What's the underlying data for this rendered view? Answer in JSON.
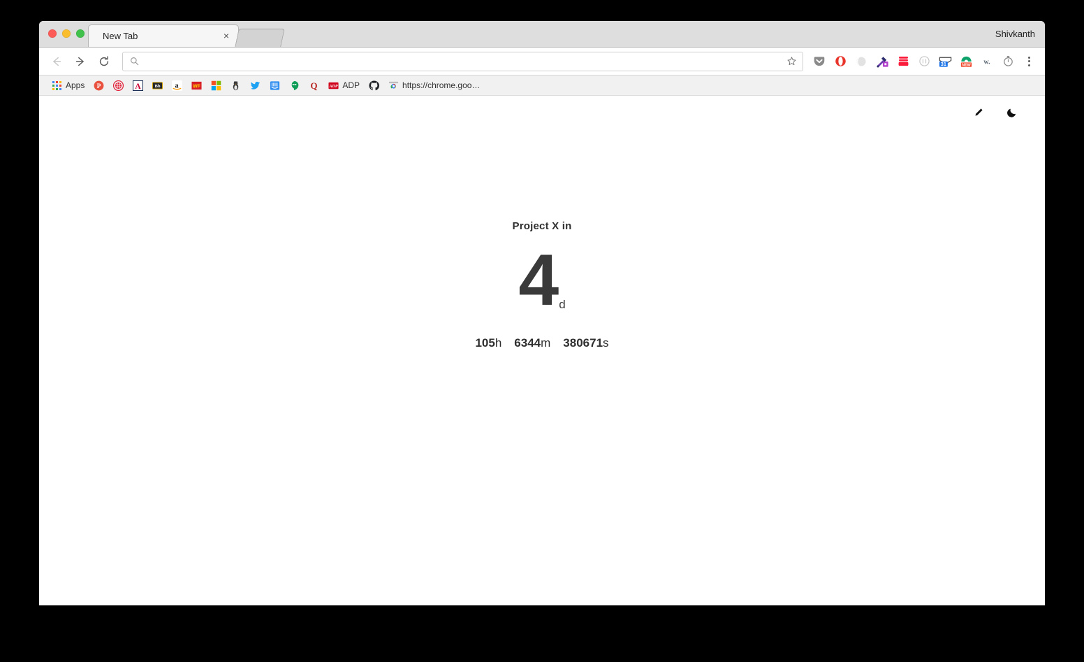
{
  "window": {
    "profile_name": "Shivkanth",
    "traffic_lights": [
      "close-red",
      "minimize-yellow",
      "maximize-green"
    ]
  },
  "tabs": [
    {
      "title": "New Tab",
      "close_label": "×",
      "active": true
    }
  ],
  "toolbar": {
    "back_label": "Back",
    "forward_label": "Forward",
    "reload_label": "Reload",
    "omnibox_value": "",
    "omnibox_placeholder": "",
    "search_icon": "search-icon",
    "star_icon": "bookmark-star-icon",
    "menu_icon": "chrome-menu-icon",
    "extensions": [
      {
        "name": "pocket-extension-icon",
        "color": "#8a8a8a"
      },
      {
        "name": "opera-extension-icon",
        "color": "#e8342a"
      },
      {
        "name": "ghost-extension-icon",
        "color": "#d8d8d8"
      },
      {
        "name": "eyedropper-extension-icon",
        "color": "#b13ecb"
      },
      {
        "name": "red-box-extension-icon",
        "color": "#fb1b3a"
      },
      {
        "name": "circle-outline-extension-icon",
        "color": "#bdbdbd"
      },
      {
        "name": "calendar-31-extension-icon",
        "color": "#1a73e8",
        "badge": "31"
      },
      {
        "name": "new-badge-extension-icon",
        "color": "#0fa36b",
        "badge": "NEW"
      },
      {
        "name": "wikiwand-extension-icon",
        "color": "#5d6a77",
        "label": "w."
      },
      {
        "name": "stopwatch-extension-icon",
        "color": "#8a8a8a"
      }
    ]
  },
  "bookmarks_bar": {
    "apps_label": "Apps",
    "items": [
      {
        "label": "",
        "icon": "pinterest-bookmark-icon",
        "color": "#e8523f"
      },
      {
        "label": "",
        "icon": "target-bookmark-icon",
        "color": "#e1243b"
      },
      {
        "label": "",
        "icon": "arizona-bookmark-icon",
        "color": "#0c234b"
      },
      {
        "label": "",
        "icon": "blackboard-bookmark-icon",
        "color": "#262626"
      },
      {
        "label": "",
        "icon": "amazon-bookmark-icon",
        "color": "#ff9900"
      },
      {
        "label": "",
        "icon": "wells-fargo-bookmark-icon",
        "color": "#d71e28"
      },
      {
        "label": "",
        "icon": "microsoft-bookmark-icon",
        "color": "#f25022"
      },
      {
        "label": "",
        "icon": "penguin-bookmark-icon",
        "color": "#3b3b3b"
      },
      {
        "label": "",
        "icon": "twitter-bookmark-icon",
        "color": "#1da1f2"
      },
      {
        "label": "",
        "icon": "blue-book-bookmark-icon",
        "color": "#2d8cf0"
      },
      {
        "label": "",
        "icon": "hangouts-bookmark-icon",
        "color": "#0f9d58"
      },
      {
        "label": "",
        "icon": "quora-bookmark-icon",
        "color": "#b92b27"
      },
      {
        "label": "ADP",
        "icon": "adp-bookmark-icon",
        "color": "#d0021b"
      },
      {
        "label": "",
        "icon": "github-bookmark-icon",
        "color": "#1b1f23"
      },
      {
        "label": "https://chrome.goo…",
        "icon": "chrome-webstore-bookmark-icon",
        "color": "#4285f4"
      }
    ]
  },
  "page": {
    "tools": [
      {
        "name": "edit-pencil-icon"
      },
      {
        "name": "dark-mode-moon-icon"
      }
    ],
    "countdown": {
      "title": "Project X in",
      "main_value": "4",
      "main_unit": "d",
      "sub_units": [
        {
          "value": "105",
          "unit": "h"
        },
        {
          "value": "6344",
          "unit": "m"
        },
        {
          "value": "380671",
          "unit": "s"
        }
      ]
    }
  },
  "colors": {
    "tabstrip_bg": "#dedede",
    "toolbar_bg": "#ffffff",
    "bookmarks_bg": "#f1f1f1",
    "page_bg": "#ffffff",
    "text_dark": "#2f2f2f",
    "desktop_bg": "#000000"
  }
}
